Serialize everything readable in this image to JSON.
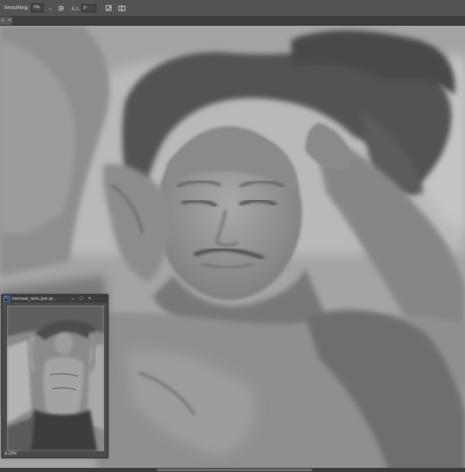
{
  "options_bar": {
    "smoothing_label": "Smoothing:",
    "smoothing_value": "0%",
    "smoothing_caret": "⌄",
    "angle_glyph": "∠△",
    "angle_value": "0°",
    "icons": [
      "settings-gear-icon",
      "pressure-size-icon",
      "symmetry-icon"
    ]
  },
  "document_tab": {
    "label": "»",
    "close": "×"
  },
  "navigator": {
    "title": "mermaid_fant1.psd @...",
    "app_badge": "Ps",
    "minimize": "–",
    "maximize": "□",
    "close": "×",
    "zoom": "6.25%"
  },
  "colors": {
    "panel": "#535353",
    "canvas_bg": "#9a9a9a"
  }
}
